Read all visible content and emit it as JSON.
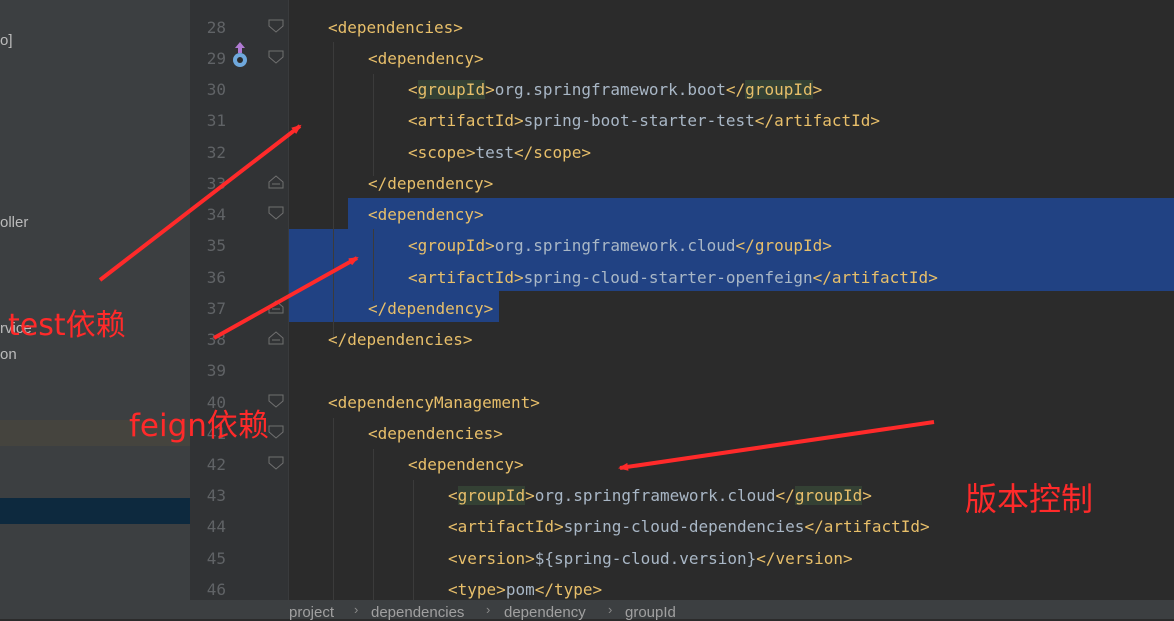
{
  "sidebar": {
    "items": [
      "o]",
      "oller",
      "rvice",
      "on"
    ]
  },
  "line_numbers": [
    "28",
    "29",
    "30",
    "31",
    "32",
    "33",
    "34",
    "35",
    "36",
    "37",
    "38",
    "39",
    "40",
    "41",
    "42",
    "43",
    "44",
    "45",
    "46"
  ],
  "code": {
    "l28": {
      "tag": "dependencies"
    },
    "l29": {
      "tag": "dependency"
    },
    "l30": {
      "open": "groupId",
      "text": "org.springframework.boot",
      "close": "groupId"
    },
    "l31": {
      "open": "artifactId",
      "text": "spring-boot-starter-test",
      "close": "artifactId"
    },
    "l32": {
      "open": "scope",
      "text": "test",
      "close": "scope"
    },
    "l33": {
      "tag": "/dependency"
    },
    "l34": {
      "tag": "dependency"
    },
    "l35": {
      "open": "groupId",
      "text": "org.springframework.cloud",
      "close": "groupId"
    },
    "l36": {
      "open": "artifactId",
      "text": "spring-cloud-starter-openfeign",
      "close": "artifactId"
    },
    "l37": {
      "tag": "/dependency"
    },
    "l38": {
      "tag": "/dependencies"
    },
    "l40": {
      "tag": "dependencyManagement"
    },
    "l41": {
      "tag": "dependencies"
    },
    "l42": {
      "tag": "dependency"
    },
    "l43": {
      "open": "groupId",
      "text": "org.springframework.cloud",
      "close": "groupId"
    },
    "l44": {
      "open": "artifactId",
      "text": "spring-cloud-dependencies",
      "close": "artifactId"
    },
    "l45": {
      "open": "version",
      "text": "${spring-cloud.version}",
      "close": "version"
    },
    "l46": {
      "open": "type",
      "text": "pom",
      "close": "type"
    }
  },
  "breadcrumb": [
    "project",
    "dependencies",
    "dependency",
    "groupId"
  ],
  "annotations": {
    "test": "test依赖",
    "feign": "feign依赖",
    "version": "版本控制"
  },
  "colors": {
    "annotation": "#ff2a2a",
    "selection": "#214283",
    "tag": "#e8bf6a",
    "text": "#a9b7c6"
  }
}
